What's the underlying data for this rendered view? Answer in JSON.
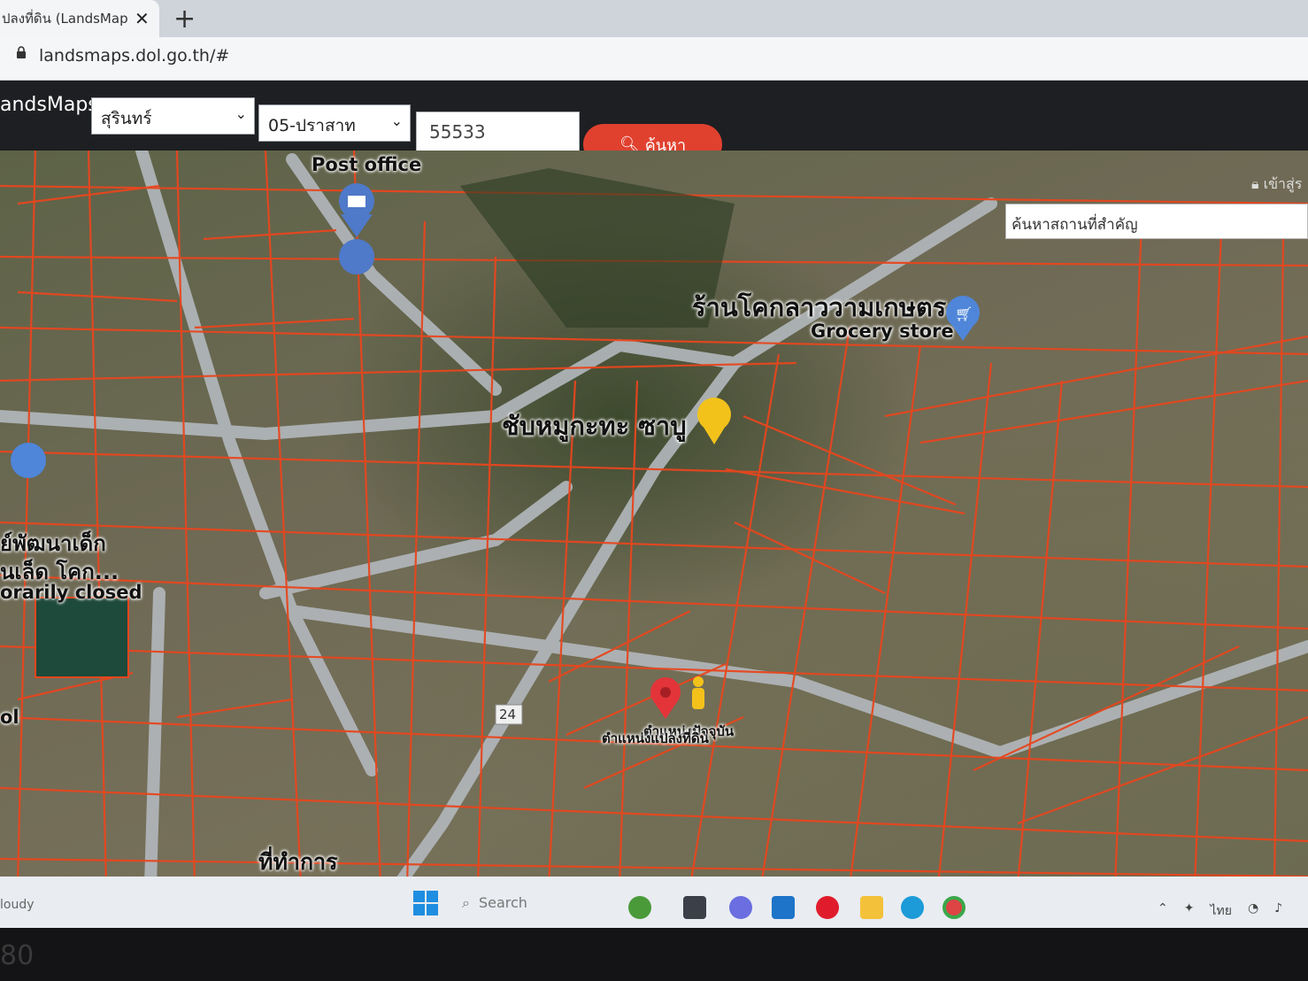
{
  "browser": {
    "tab_title": "ปลงที่ดิน (LandsMaps",
    "url": "landsmaps.dol.go.th/#"
  },
  "app": {
    "brand": "andsMaps",
    "province_value": "สุรินทร์",
    "district_value": "05-ปราสาท",
    "parcel_value": "55533",
    "search_label": "ค้นหา",
    "login_label": "เข้าสู่ร",
    "place_search_placeholder": "ค้นหาสถานที่สำคัญ"
  },
  "map": {
    "labels": {
      "post_office": "Post office",
      "shop_thai": "ร้านโคกลาววามเกษตร",
      "grocery": "Grocery store",
      "restaurant": "ชับหมูกะทะ ซาบู",
      "left_thai_1": "ย์พัฒนาเด็ก",
      "left_thai_2": "นเล็ด โคก...",
      "temp_closed": "orarily closed",
      "left_ool": "ol",
      "route": "24",
      "pin_label_1": "ตำแหน่งปัจจุบัน",
      "pin_label_2": "ตำแหน่งแปลงที่ดิน",
      "bottom_thai": "ที่ทำการ"
    },
    "colors": {
      "parcel_line": "#e8461e",
      "road": "#b9bec4",
      "pin_red": "#e3343a",
      "pin_yellow": "#f2c21b",
      "pin_blue": "#4f86d9"
    }
  },
  "taskbar": {
    "weather": "loudy",
    "search_label": "Search",
    "tray_lang": "ไทย",
    "icons": [
      "widgets-icon",
      "file-manager-icon",
      "chat-icon",
      "mail-icon",
      "opera-icon",
      "folder-icon",
      "edge-icon",
      "chrome-icon"
    ]
  },
  "bezel": {
    "model": "80"
  }
}
